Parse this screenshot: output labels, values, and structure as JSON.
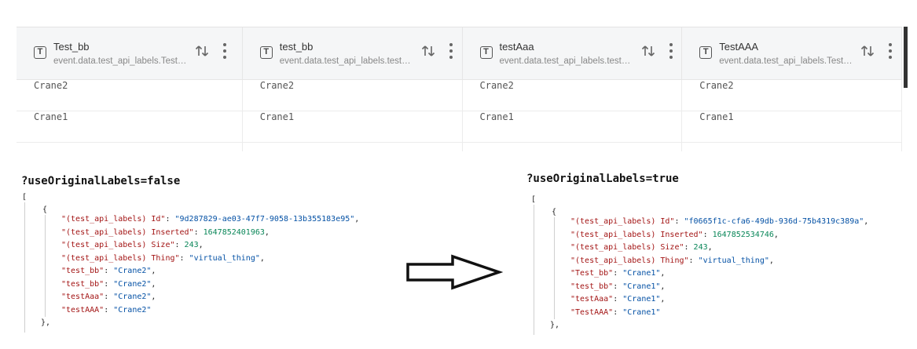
{
  "table": {
    "columns": [
      {
        "title": "Test_bb",
        "path": "event.data.test_api_labels.Test_bb"
      },
      {
        "title": "test_bb",
        "path": "event.data.test_api_labels.test_bb"
      },
      {
        "title": "testAaa",
        "path": "event.data.test_api_labels.testAaa"
      },
      {
        "title": "TestAAA",
        "path": "event.data.test_api_labels.TestAAA"
      }
    ],
    "type_icon_glyph": "T",
    "rows": [
      [
        "Crane2",
        "Crane2",
        "Crane2",
        "Crane2"
      ],
      [
        "Crane1",
        "Crane1",
        "Crane1",
        "Crane1"
      ]
    ]
  },
  "left": {
    "title": "?useOriginalLabels=false",
    "open_bracket": "[",
    "open_brace": "{",
    "close_brace": "},",
    "entries": [
      {
        "key": "\"(test_api_labels) Id\"",
        "value": "\"9d287829-ae03-47f7-9058-13b355183e95\"",
        "kind": "s"
      },
      {
        "key": "\"(test_api_labels) Inserted\"",
        "value": "1647852401963",
        "kind": "n"
      },
      {
        "key": "\"(test_api_labels) Size\"",
        "value": "243",
        "kind": "n"
      },
      {
        "key": "\"(test_api_labels) Thing\"",
        "value": "\"virtual_thing\"",
        "kind": "s"
      },
      {
        "key": "\"test_bb\"",
        "value": "\"Crane2\"",
        "kind": "s"
      },
      {
        "key": "\"test_bb\"",
        "value": "\"Crane2\"",
        "kind": "s"
      },
      {
        "key": "\"testAaa\"",
        "value": "\"Crane2\"",
        "kind": "s"
      },
      {
        "key": "\"testAAA\"",
        "value": "\"Crane2\"",
        "kind": "s",
        "last": true
      }
    ]
  },
  "right": {
    "title": "?useOriginalLabels=true",
    "open_bracket": "[",
    "open_brace": "{",
    "close_brace": "},",
    "entries": [
      {
        "key": "\"(test_api_labels) Id\"",
        "value": "\"f0665f1c-cfa6-49db-936d-75b4319c389a\"",
        "kind": "s"
      },
      {
        "key": "\"(test_api_labels) Inserted\"",
        "value": "1647852534746",
        "kind": "n"
      },
      {
        "key": "\"(test_api_labels) Size\"",
        "value": "243",
        "kind": "n"
      },
      {
        "key": "\"(test_api_labels) Thing\"",
        "value": "\"virtual_thing\"",
        "kind": "s"
      },
      {
        "key": "\"Test_bb\"",
        "value": "\"Crane1\"",
        "kind": "s"
      },
      {
        "key": "\"test_bb\"",
        "value": "\"Crane1\"",
        "kind": "s"
      },
      {
        "key": "\"testAaa\"",
        "value": "\"Crane1\"",
        "kind": "s"
      },
      {
        "key": "\"TestAAA\"",
        "value": "\"Crane1\"",
        "kind": "s",
        "last": true
      }
    ]
  },
  "colors": {
    "key": "#a31515",
    "string": "#0451a5",
    "number": "#098658"
  },
  "icons": {
    "column_type": "text-type-icon",
    "sort": "sort-arrows-icon",
    "menu": "more-vertical-icon",
    "comparison": "right-arrow-icon"
  }
}
